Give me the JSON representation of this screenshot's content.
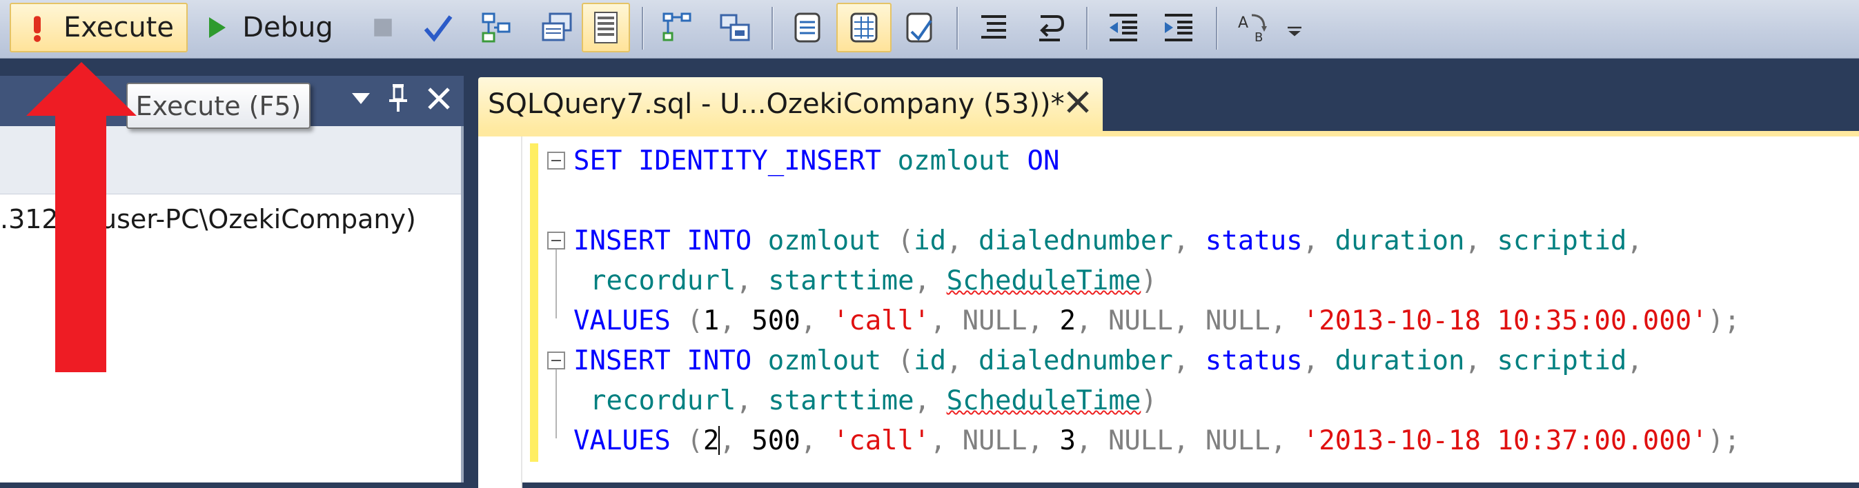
{
  "toolbar": {
    "execute_label": "Execute",
    "debug_label": "Debug"
  },
  "tooltip": {
    "text": "Execute (F5)"
  },
  "object_explorer": {
    "tree_item": ".312 ... user-PC\\OzekiCompany)"
  },
  "editor": {
    "tab_title": "SQLQuery7.sql - U...OzekiCompany (53))*"
  },
  "code": {
    "line1": [
      "SET",
      "IDENTITY_INSERT",
      "ozmlout",
      "ON"
    ],
    "insert1": {
      "insert_into": "INSERT INTO",
      "table": "ozmlout",
      "open": "(",
      "cols1": [
        "id",
        "dialednumber",
        "status",
        "duration",
        "scriptid"
      ],
      "cols2": [
        "recordurl",
        "starttime",
        "ScheduleTime"
      ],
      "close": ")",
      "values_kw": "VALUES",
      "values": [
        "1",
        "500",
        "'call'",
        "NULL",
        "2",
        "NULL",
        "NULL",
        "'2013-10-18 10:35:00.000'"
      ]
    },
    "insert2": {
      "insert_into": "INSERT INTO",
      "table": "ozmlout",
      "open": "(",
      "cols1": [
        "id",
        "dialednumber",
        "status",
        "duration",
        "scriptid"
      ],
      "cols2": [
        "recordurl",
        "starttime",
        "ScheduleTime"
      ],
      "close": ")",
      "values_kw": "VALUES",
      "values": [
        "2",
        "500",
        "'call'",
        "NULL",
        "3",
        "NULL",
        "NULL",
        "'2013-10-18 10:37:00.000'"
      ]
    }
  },
  "colors": {
    "keyword": "#0000ff",
    "identifier": "#008080",
    "string": "#e01010",
    "null_gray": "#808080",
    "arrow": "#ee1c24"
  },
  "icons": [
    "exclamation-icon",
    "play-icon",
    "stop-icon",
    "check-icon",
    "parse-icon",
    "display-plan-icon",
    "results-grid-icon",
    "query-options-icon",
    "include-plan-icon",
    "client-stats-icon",
    "results-to-text-icon",
    "results-to-grid-icon",
    "results-to-file-icon",
    "comment-icon",
    "uncomment-icon",
    "decrease-indent-icon",
    "increase-indent-icon",
    "specify-values-icon",
    "overflow-icon"
  ]
}
